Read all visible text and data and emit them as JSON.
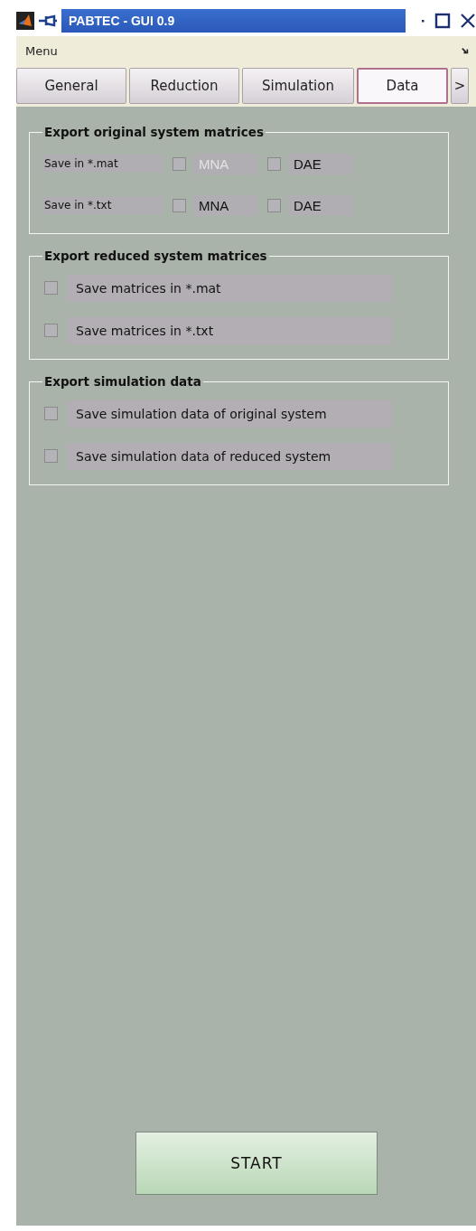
{
  "window": {
    "title": "PABTEC - GUI 0.9"
  },
  "menu": {
    "label": "Menu"
  },
  "tabs": [
    {
      "label": "General",
      "selected": false
    },
    {
      "label": "Reduction",
      "selected": false
    },
    {
      "label": "Simulation",
      "selected": false
    },
    {
      "label": "Data",
      "selected": true
    }
  ],
  "tab_scroll": ">",
  "original_group": {
    "title": "Export original system matrices",
    "rows": [
      {
        "label": "Save in *.mat",
        "options": [
          {
            "label": "MNA",
            "checked": false,
            "disabled": true
          },
          {
            "label": "DAE",
            "checked": false,
            "disabled": false
          }
        ]
      },
      {
        "label": "Save in *.txt",
        "options": [
          {
            "label": "MNA",
            "checked": false,
            "disabled": false
          },
          {
            "label": "DAE",
            "checked": false,
            "disabled": false
          }
        ]
      }
    ]
  },
  "groups": [
    {
      "title": "Export reduced system matrices",
      "items": [
        {
          "label": "Save matrices in *.mat",
          "checked": false
        },
        {
          "label": "Save matrices in *.txt",
          "checked": false
        }
      ]
    },
    {
      "title": "Export simulation data",
      "items": [
        {
          "label": "Save simulation data of original system",
          "checked": false
        },
        {
          "label": "Save simulation data of reduced system",
          "checked": false
        }
      ]
    }
  ],
  "start_button": "START"
}
